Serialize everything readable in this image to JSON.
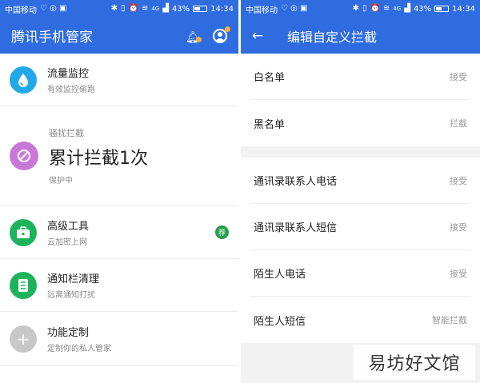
{
  "status_bar": {
    "carrier": "中国移动",
    "battery": "43%",
    "time": "14:34",
    "network": "4G"
  },
  "left_screen": {
    "app_title": "腾讯手机管家",
    "items": [
      {
        "title": "流量监控",
        "subtitle": "有效监控偷跑",
        "icon": "water-drop-icon",
        "color": "#21a8e8"
      },
      {
        "title": "高级工具",
        "subtitle": "云加密上网",
        "icon": "toolbox-icon",
        "color": "#1db35c",
        "badge": "荐"
      },
      {
        "title": "通知栏清理",
        "subtitle": "远离通知打扰",
        "icon": "notification-icon",
        "color": "#1db35c"
      },
      {
        "title": "功能定制",
        "subtitle": "定制你的私人管家",
        "icon": "plus-icon",
        "color": "#c8c8c8"
      }
    ],
    "harassment": {
      "label": "骚扰拦截",
      "headline": "累计拦截1次",
      "status": "保护中",
      "icon": "block-icon",
      "color": "#c978d8"
    }
  },
  "right_screen": {
    "title": "编辑自定义拦截",
    "section1": [
      {
        "label": "白名单",
        "value": "接受"
      },
      {
        "label": "黑名单",
        "value": "拦截"
      }
    ],
    "section2": [
      {
        "label": "通讯录联系人电话",
        "value": "接受"
      },
      {
        "label": "通讯录联系人短信",
        "value": "接受"
      },
      {
        "label": "陌生人电话",
        "value": "接受"
      },
      {
        "label": "陌生人短信",
        "value": "智能拦截"
      }
    ]
  },
  "watermark": "易坊好文馆",
  "colors": {
    "primary": "#2f6cdf",
    "accent_badge": "#23a14b",
    "notification_dot": "#f5b13b"
  }
}
